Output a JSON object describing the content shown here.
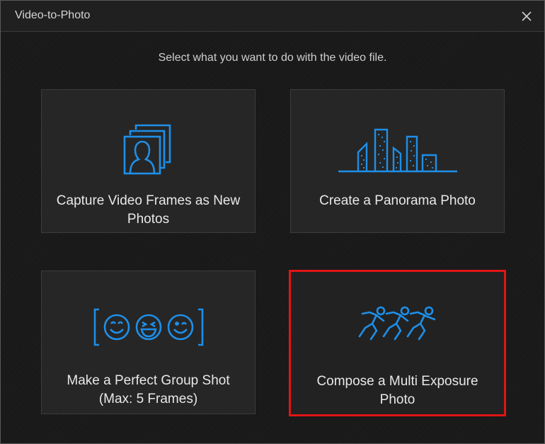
{
  "window": {
    "title": "Video-to-Photo"
  },
  "prompt": "Select what you want to do with the video file.",
  "options": [
    {
      "label": "Capture Video Frames as New Photos",
      "icon": "portrait-frames-icon"
    },
    {
      "label": "Create a Panorama Photo",
      "icon": "city-skyline-icon"
    },
    {
      "label": "Make a Perfect Group Shot (Max: 5 Frames)",
      "icon": "group-faces-icon"
    },
    {
      "label": "Compose a Multi Exposure Photo",
      "icon": "running-figures-icon",
      "selected": true
    }
  ],
  "colors": {
    "accent_icon": "#1e8fe8",
    "selection_border": "#e01515",
    "text": "#e8e8e8"
  }
}
